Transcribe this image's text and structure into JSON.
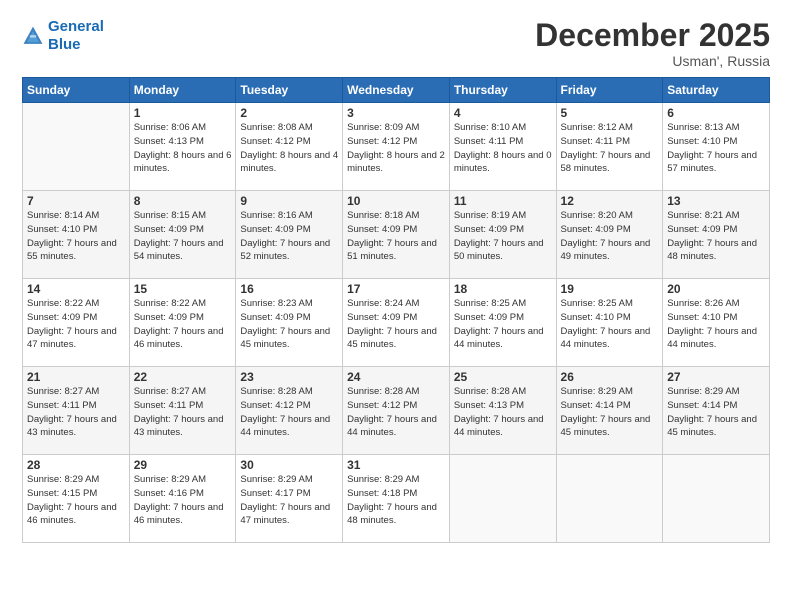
{
  "header": {
    "logo_line1": "General",
    "logo_line2": "Blue",
    "month": "December 2025",
    "location": "Usman', Russia"
  },
  "days_of_week": [
    "Sunday",
    "Monday",
    "Tuesday",
    "Wednesday",
    "Thursday",
    "Friday",
    "Saturday"
  ],
  "weeks": [
    [
      {
        "day": "",
        "sunrise": "",
        "sunset": "",
        "daylight": ""
      },
      {
        "day": "1",
        "sunrise": "Sunrise: 8:06 AM",
        "sunset": "Sunset: 4:13 PM",
        "daylight": "Daylight: 8 hours and 6 minutes."
      },
      {
        "day": "2",
        "sunrise": "Sunrise: 8:08 AM",
        "sunset": "Sunset: 4:12 PM",
        "daylight": "Daylight: 8 hours and 4 minutes."
      },
      {
        "day": "3",
        "sunrise": "Sunrise: 8:09 AM",
        "sunset": "Sunset: 4:12 PM",
        "daylight": "Daylight: 8 hours and 2 minutes."
      },
      {
        "day": "4",
        "sunrise": "Sunrise: 8:10 AM",
        "sunset": "Sunset: 4:11 PM",
        "daylight": "Daylight: 8 hours and 0 minutes."
      },
      {
        "day": "5",
        "sunrise": "Sunrise: 8:12 AM",
        "sunset": "Sunset: 4:11 PM",
        "daylight": "Daylight: 7 hours and 58 minutes."
      },
      {
        "day": "6",
        "sunrise": "Sunrise: 8:13 AM",
        "sunset": "Sunset: 4:10 PM",
        "daylight": "Daylight: 7 hours and 57 minutes."
      }
    ],
    [
      {
        "day": "7",
        "sunrise": "Sunrise: 8:14 AM",
        "sunset": "Sunset: 4:10 PM",
        "daylight": "Daylight: 7 hours and 55 minutes."
      },
      {
        "day": "8",
        "sunrise": "Sunrise: 8:15 AM",
        "sunset": "Sunset: 4:09 PM",
        "daylight": "Daylight: 7 hours and 54 minutes."
      },
      {
        "day": "9",
        "sunrise": "Sunrise: 8:16 AM",
        "sunset": "Sunset: 4:09 PM",
        "daylight": "Daylight: 7 hours and 52 minutes."
      },
      {
        "day": "10",
        "sunrise": "Sunrise: 8:18 AM",
        "sunset": "Sunset: 4:09 PM",
        "daylight": "Daylight: 7 hours and 51 minutes."
      },
      {
        "day": "11",
        "sunrise": "Sunrise: 8:19 AM",
        "sunset": "Sunset: 4:09 PM",
        "daylight": "Daylight: 7 hours and 50 minutes."
      },
      {
        "day": "12",
        "sunrise": "Sunrise: 8:20 AM",
        "sunset": "Sunset: 4:09 PM",
        "daylight": "Daylight: 7 hours and 49 minutes."
      },
      {
        "day": "13",
        "sunrise": "Sunrise: 8:21 AM",
        "sunset": "Sunset: 4:09 PM",
        "daylight": "Daylight: 7 hours and 48 minutes."
      }
    ],
    [
      {
        "day": "14",
        "sunrise": "Sunrise: 8:22 AM",
        "sunset": "Sunset: 4:09 PM",
        "daylight": "Daylight: 7 hours and 47 minutes."
      },
      {
        "day": "15",
        "sunrise": "Sunrise: 8:22 AM",
        "sunset": "Sunset: 4:09 PM",
        "daylight": "Daylight: 7 hours and 46 minutes."
      },
      {
        "day": "16",
        "sunrise": "Sunrise: 8:23 AM",
        "sunset": "Sunset: 4:09 PM",
        "daylight": "Daylight: 7 hours and 45 minutes."
      },
      {
        "day": "17",
        "sunrise": "Sunrise: 8:24 AM",
        "sunset": "Sunset: 4:09 PM",
        "daylight": "Daylight: 7 hours and 45 minutes."
      },
      {
        "day": "18",
        "sunrise": "Sunrise: 8:25 AM",
        "sunset": "Sunset: 4:09 PM",
        "daylight": "Daylight: 7 hours and 44 minutes."
      },
      {
        "day": "19",
        "sunrise": "Sunrise: 8:25 AM",
        "sunset": "Sunset: 4:10 PM",
        "daylight": "Daylight: 7 hours and 44 minutes."
      },
      {
        "day": "20",
        "sunrise": "Sunrise: 8:26 AM",
        "sunset": "Sunset: 4:10 PM",
        "daylight": "Daylight: 7 hours and 44 minutes."
      }
    ],
    [
      {
        "day": "21",
        "sunrise": "Sunrise: 8:27 AM",
        "sunset": "Sunset: 4:11 PM",
        "daylight": "Daylight: 7 hours and 43 minutes."
      },
      {
        "day": "22",
        "sunrise": "Sunrise: 8:27 AM",
        "sunset": "Sunset: 4:11 PM",
        "daylight": "Daylight: 7 hours and 43 minutes."
      },
      {
        "day": "23",
        "sunrise": "Sunrise: 8:28 AM",
        "sunset": "Sunset: 4:12 PM",
        "daylight": "Daylight: 7 hours and 44 minutes."
      },
      {
        "day": "24",
        "sunrise": "Sunrise: 8:28 AM",
        "sunset": "Sunset: 4:12 PM",
        "daylight": "Daylight: 7 hours and 44 minutes."
      },
      {
        "day": "25",
        "sunrise": "Sunrise: 8:28 AM",
        "sunset": "Sunset: 4:13 PM",
        "daylight": "Daylight: 7 hours and 44 minutes."
      },
      {
        "day": "26",
        "sunrise": "Sunrise: 8:29 AM",
        "sunset": "Sunset: 4:14 PM",
        "daylight": "Daylight: 7 hours and 45 minutes."
      },
      {
        "day": "27",
        "sunrise": "Sunrise: 8:29 AM",
        "sunset": "Sunset: 4:14 PM",
        "daylight": "Daylight: 7 hours and 45 minutes."
      }
    ],
    [
      {
        "day": "28",
        "sunrise": "Sunrise: 8:29 AM",
        "sunset": "Sunset: 4:15 PM",
        "daylight": "Daylight: 7 hours and 46 minutes."
      },
      {
        "day": "29",
        "sunrise": "Sunrise: 8:29 AM",
        "sunset": "Sunset: 4:16 PM",
        "daylight": "Daylight: 7 hours and 46 minutes."
      },
      {
        "day": "30",
        "sunrise": "Sunrise: 8:29 AM",
        "sunset": "Sunset: 4:17 PM",
        "daylight": "Daylight: 7 hours and 47 minutes."
      },
      {
        "day": "31",
        "sunrise": "Sunrise: 8:29 AM",
        "sunset": "Sunset: 4:18 PM",
        "daylight": "Daylight: 7 hours and 48 minutes."
      },
      {
        "day": "",
        "sunrise": "",
        "sunset": "",
        "daylight": ""
      },
      {
        "day": "",
        "sunrise": "",
        "sunset": "",
        "daylight": ""
      },
      {
        "day": "",
        "sunrise": "",
        "sunset": "",
        "daylight": ""
      }
    ]
  ]
}
